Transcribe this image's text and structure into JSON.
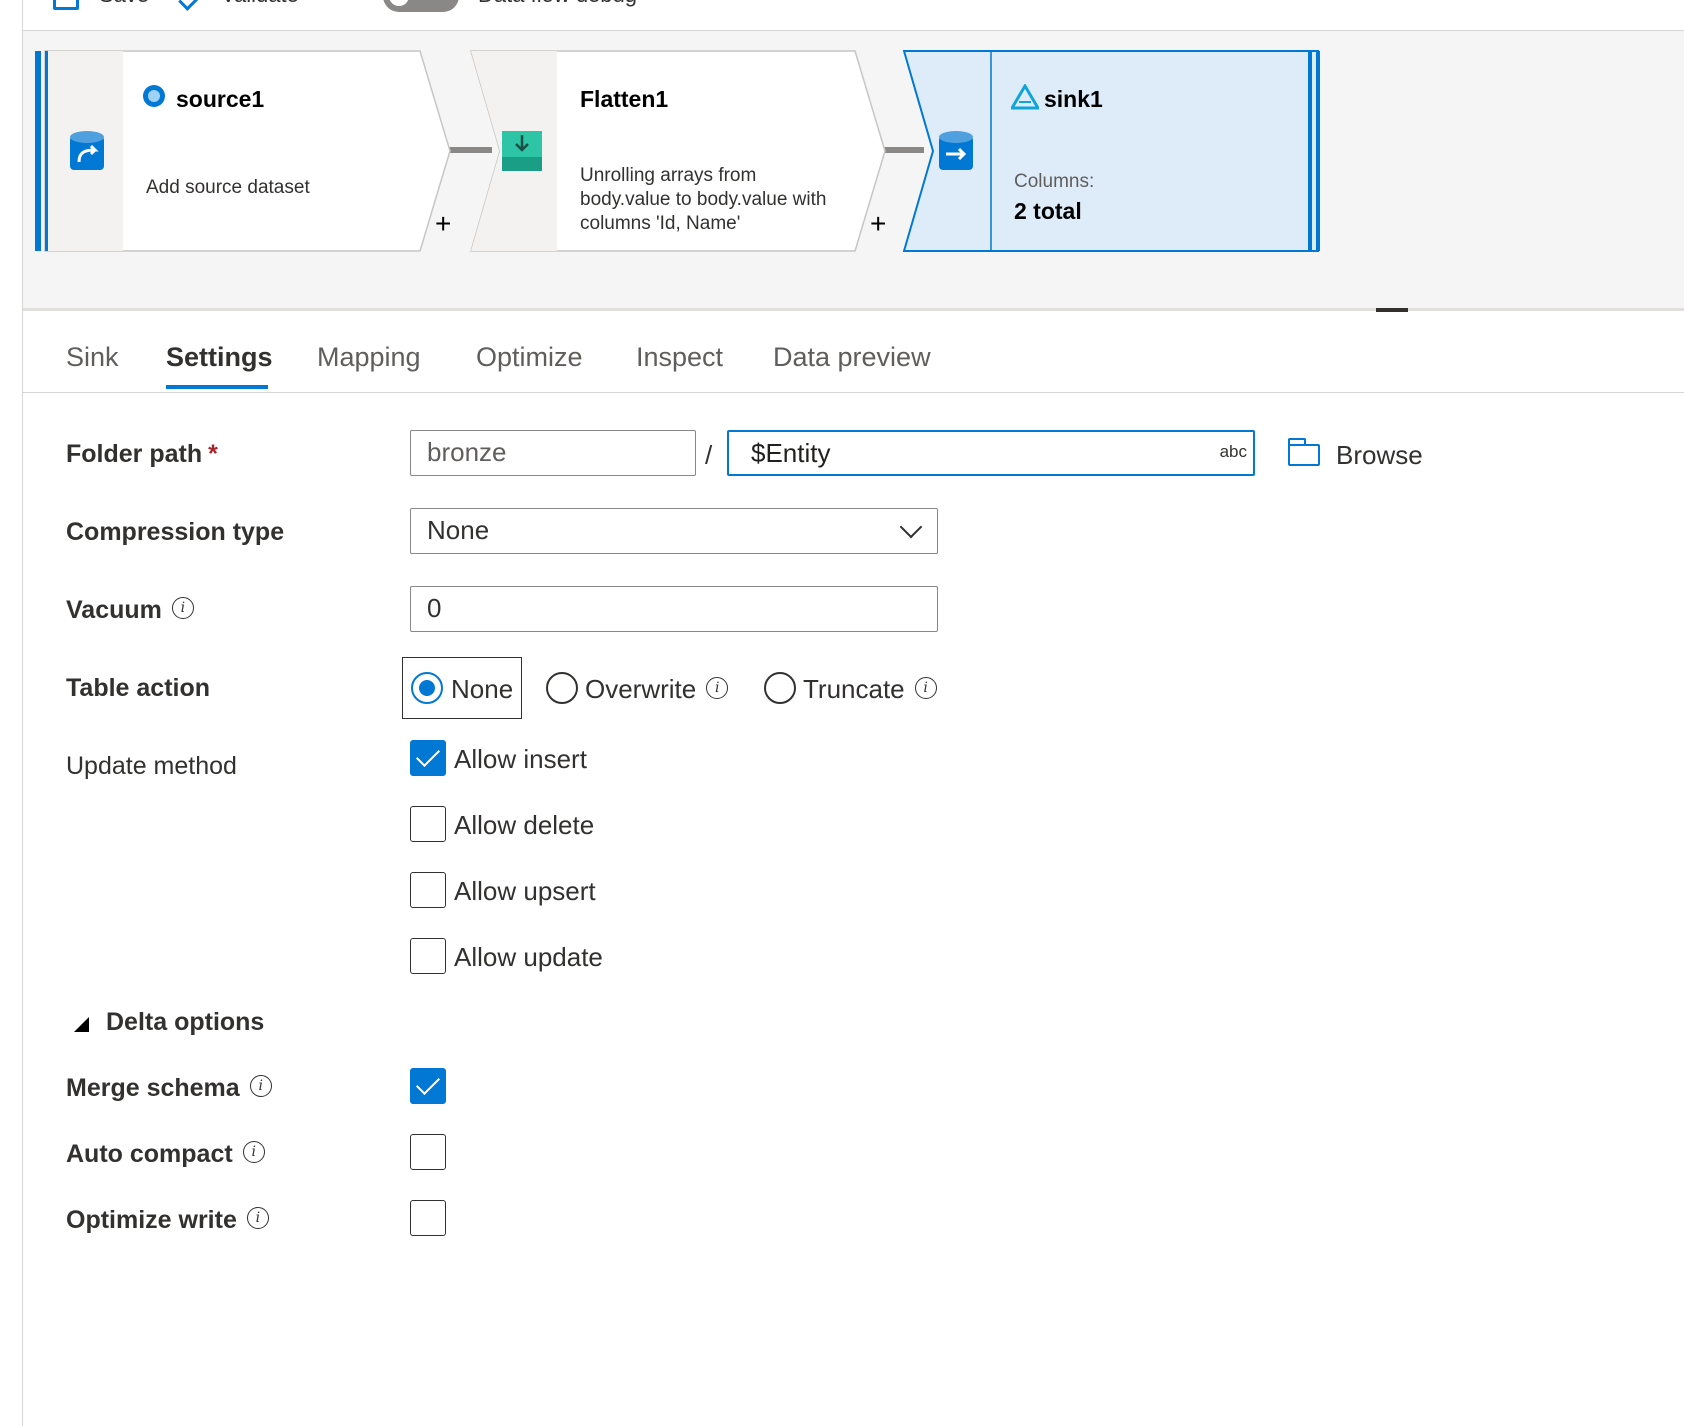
{
  "toolbar": {
    "save_label": "Save",
    "validate_label": "Validate",
    "debug_label": "Data flow debug"
  },
  "pipeline": {
    "source": {
      "title": "source1",
      "subtitle": "Add source dataset"
    },
    "flatten": {
      "title": "Flatten1",
      "lines": [
        "Unrolling arrays from",
        "body.value to body.value with",
        "columns 'Id, Name'"
      ]
    },
    "sink": {
      "title": "sink1",
      "columns_label": "Columns:",
      "columns_value": "2 total"
    },
    "add_symbol": "+"
  },
  "tabs": [
    "Sink",
    "Settings",
    "Mapping",
    "Optimize",
    "Inspect",
    "Data preview"
  ],
  "active_tab": "Settings",
  "form": {
    "folder_path": {
      "label": "Folder path",
      "required_mark": "*",
      "container": "bronze",
      "separator": "/",
      "directory": "$Entity",
      "type_hint": "abc",
      "browse_label": "Browse"
    },
    "compression_type": {
      "label": "Compression type",
      "value": "None"
    },
    "vacuum": {
      "label": "Vacuum",
      "value": "0"
    },
    "table_action": {
      "label": "Table action",
      "options": [
        "None",
        "Overwrite",
        "Truncate"
      ],
      "selected": "None"
    },
    "update_method": {
      "label": "Update method",
      "options": [
        {
          "label": "Allow insert",
          "checked": true
        },
        {
          "label": "Allow delete",
          "checked": false
        },
        {
          "label": "Allow upsert",
          "checked": false
        },
        {
          "label": "Allow update",
          "checked": false
        }
      ]
    },
    "delta_options": {
      "label": "Delta options",
      "merge_schema": {
        "label": "Merge schema",
        "checked": true
      },
      "auto_compact": {
        "label": "Auto compact",
        "checked": false
      },
      "optimize_write": {
        "label": "Optimize write",
        "checked": false
      }
    },
    "info_symbol": "i"
  },
  "colors": {
    "accent": "#0078d4",
    "sink_bg": "#deecf9",
    "flatten_icon": "#2ec4a6"
  }
}
